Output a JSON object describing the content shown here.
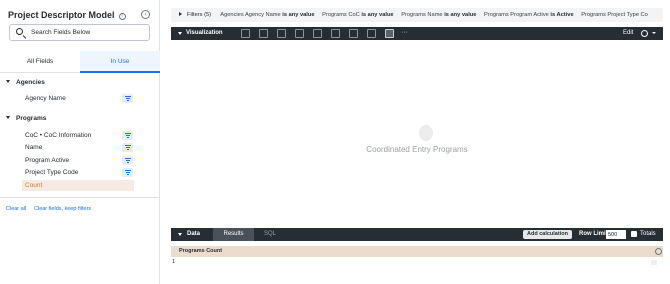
{
  "left_panel": {
    "title": "Project Descriptor Model",
    "info_icon": "i",
    "collapse_icon": "‹",
    "search": {
      "placeholder": "Search Fields Below",
      "value": ""
    },
    "tabs": [
      {
        "label": "All Fields",
        "active": false
      },
      {
        "label": "In Use",
        "active": true
      }
    ],
    "groups": [
      {
        "label": "Agencies",
        "fields": [
          {
            "label": "Agency Name",
            "filter": true
          }
        ]
      },
      {
        "label": "Programs",
        "fields": [
          {
            "label": "CoC • CoC Information",
            "filter": true
          },
          {
            "label": "Name",
            "filter": true
          },
          {
            "label": "Program Active",
            "filter": true
          },
          {
            "label": "Project Type Code",
            "filter": true
          },
          {
            "label": "Count",
            "filter": false,
            "selected": true
          }
        ]
      }
    ],
    "links": {
      "clear_all": "Clear all",
      "clear_fields": "Clear fields, keep filters"
    }
  },
  "filters": {
    "label": "Filters (5)",
    "chips": [
      {
        "field": "Agencies Agency Name",
        "cond": "is any value"
      },
      {
        "field": "Programs CoC",
        "cond": "is any value"
      },
      {
        "field": "Programs Name",
        "cond": "is any value"
      },
      {
        "field": "Programs Program Active",
        "cond": "is Active"
      },
      {
        "field": "Programs Project Type Co",
        "cond": ""
      }
    ]
  },
  "visualization": {
    "title": "Visualization",
    "edit_label": "Edit",
    "more": "···",
    "body_text": "Coordinated Entry Programs"
  },
  "data": {
    "title": "Data",
    "tabs": {
      "results": "Results",
      "sql": "SQL"
    },
    "add_calculation": "Add calculation",
    "row_limit_label": "Row Limit",
    "row_limit_value": "500",
    "totals_label": "Totals",
    "column": "Programs Count",
    "row_number": "1"
  },
  "colors": {
    "accent": "#1a73e8",
    "toolbar": "#262d33",
    "dimension_header": "#ecdcd0",
    "measure_text": "#c77a36"
  }
}
